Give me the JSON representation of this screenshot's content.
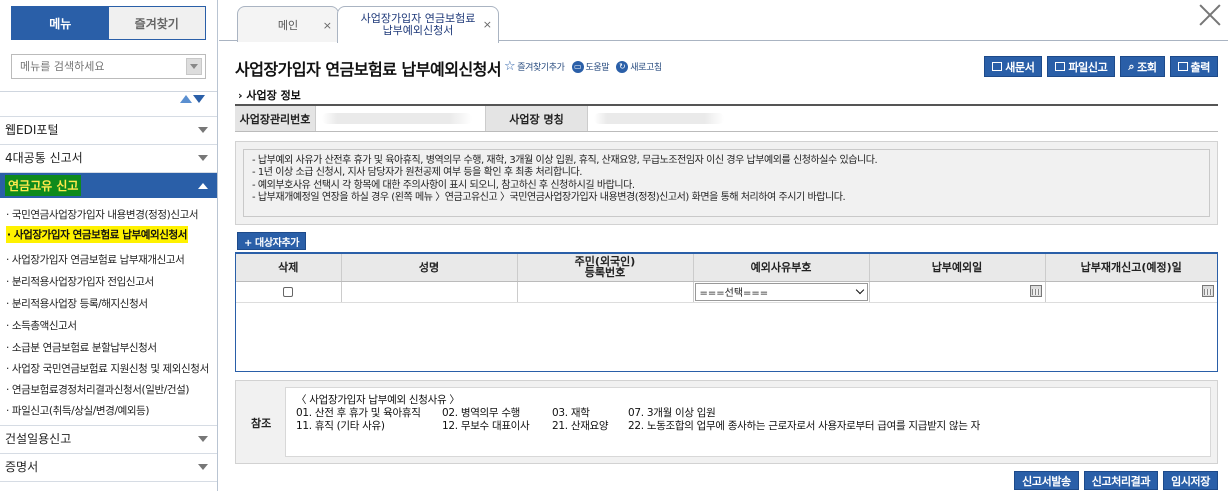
{
  "sidebar": {
    "tab_menu": "메뉴",
    "tab_favorites": "즐겨찾기",
    "search_placeholder": "메뉴를 검색하세요",
    "groups": [
      {
        "label": "웹EDI포털"
      },
      {
        "label": "4대공통 신고서"
      },
      {
        "label": "연금고유 신고"
      }
    ],
    "sub_items": [
      "· 국민연금사업장가입자 내용변경(정정)신고서",
      "· 사업장가입자 연금보험료 납부예외신청서",
      "· 사업장가입자 연금보험료 납부재개신고서",
      "· 분리적용사업장가입자 전입신고서",
      "· 분리적용사업장 등록/해지신청서",
      "· 소득총액신고서",
      "· 소급분 연금보험료 분할납부신청서",
      "· 사업장 국민연금보험료 지원신청 및 제외신청서",
      "· 연금보험료경정처리결과신청서(일반/건설)",
      "· 파일신고(취득/상실/변경/예외등)"
    ],
    "groups_after": [
      {
        "label": "건설일용신고"
      },
      {
        "label": "증명서"
      }
    ]
  },
  "tabs": {
    "main_label": "메인",
    "current_line1": "사업장가입자 연금보험료",
    "current_line2": "납부예외신청서",
    "close_x": "×"
  },
  "header": {
    "title": "사업장가입자 연금보험료 납부예외신청서",
    "link_favorite": "즐겨찾기추가",
    "link_help": "도움말",
    "link_refresh": "새로고침"
  },
  "toolbar": {
    "new_doc": "새문서",
    "file_report": "파일신고",
    "search": "조회",
    "print": "출력"
  },
  "biz_info": {
    "section_title": "사업장 정보",
    "mgmt_no_label": "사업장관리번호",
    "name_label": "사업장 명칭"
  },
  "notice": [
    "- 납부예외 사유가 산전후 휴가 및 육아휴직, 병역의무 수행, 재학, 3개월 이상 입원, 휴직, 산재요양, 무급노조전임자 이신 경우 납부예외를 신청하실수 있습니다.",
    "- 1년 이상 소급 신청시, 지사 담당자가 원천공제 여부 등을 확인 후 최종 처리합니다.",
    "- 예외부호사유 선택시 각 항목에 대한 주의사항이 표시 되오니, 참고하신 후 신청하시길 바랍니다.",
    "- 납부재개예정일 연장을 하실 경우 (왼쪽 메뉴 〉연금고유신고 〉국민연금사업장가입자 내용변경(정정)신고서) 화면을 통해 처리하여 주시기 바랍니다."
  ],
  "target": {
    "add_button": "+ 대상자추가",
    "columns": [
      "삭제",
      "성명",
      "주민(외국인)",
      "등록번호",
      "예외사유부호",
      "납부예외일",
      "납부재개신고(예정)일"
    ],
    "select_value": "===선택==="
  },
  "reference": {
    "label": "참조",
    "heading": "〈 사업장가입자 납부예외 신청사유 〉",
    "row1": [
      "01. 산전 후 휴가 및 육아휴직",
      "02. 병역의무 수행",
      "03. 재학",
      "07. 3개월 이상 입원"
    ],
    "row2": [
      "11. 휴직 (기타 사유)",
      "12. 무보수 대표이사",
      "21. 산재요양",
      "22. 노동조합의 업무에 종사하는 근로자로서 사용자로부터 급여를 지급받지 않는 자"
    ]
  },
  "bottom": {
    "submit": "신고서발송",
    "result": "신고처리결과",
    "temp_save": "임시저장"
  }
}
